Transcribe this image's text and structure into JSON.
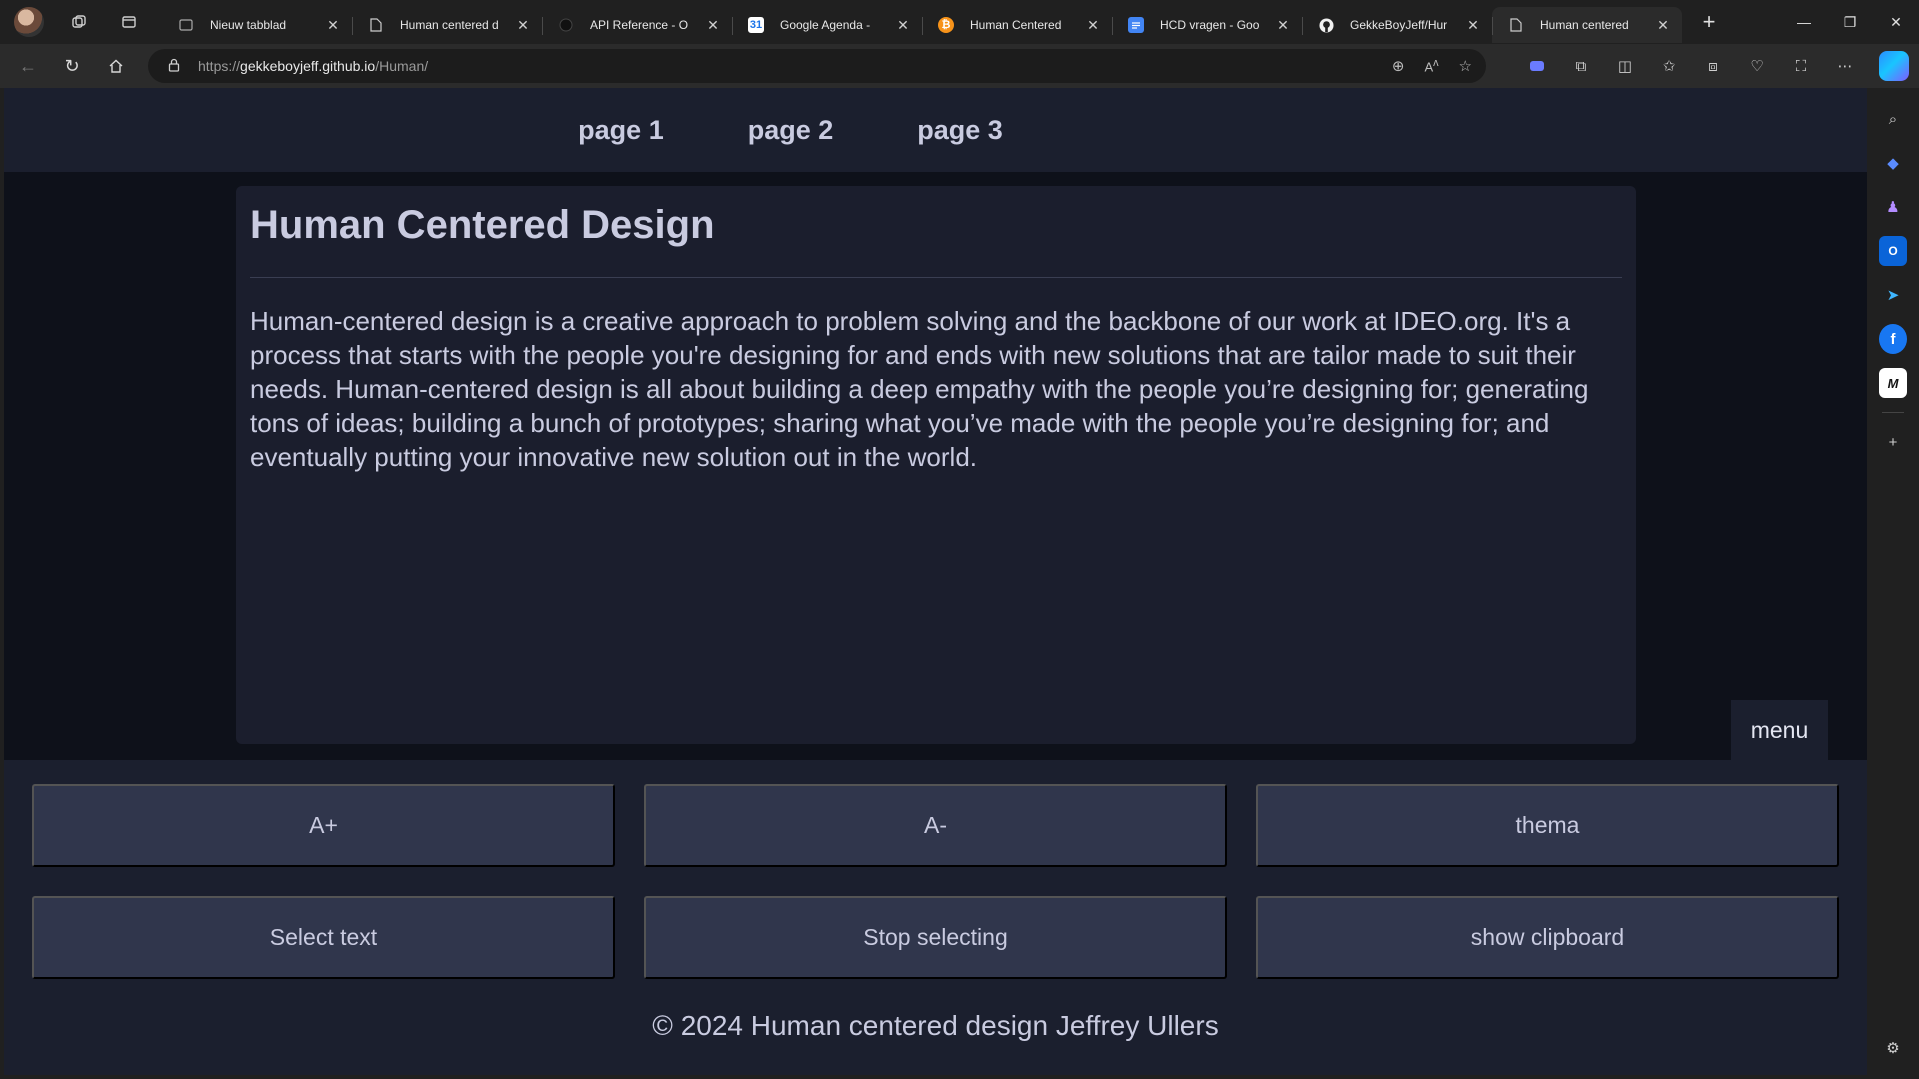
{
  "browser": {
    "tabs": [
      {
        "title": "Nieuw tabblad",
        "icon": "new-tab-page-icon",
        "active": false
      },
      {
        "title": "Human centered d",
        "icon": "document-icon",
        "active": false
      },
      {
        "title": "API Reference - O",
        "icon": "openai-icon",
        "active": false
      },
      {
        "title": "Google Agenda -",
        "icon": "google-calendar-icon",
        "active": false
      },
      {
        "title": "Human Centered",
        "icon": "bitcoin-icon",
        "active": false
      },
      {
        "title": "HCD vragen - Goo",
        "icon": "google-docs-icon",
        "active": false
      },
      {
        "title": "GekkeBoyJeff/Hur",
        "icon": "github-icon",
        "active": false
      },
      {
        "title": "Human centered",
        "icon": "document-icon",
        "active": true
      }
    ],
    "address": {
      "scheme": "https://",
      "host": "gekkeboyjeff.github.io",
      "path": "/Human/"
    }
  },
  "page": {
    "nav": [
      "page 1",
      "page 2",
      "page 3"
    ],
    "title": "Human Centered Design",
    "body": "Human-centered design is a creative approach to problem solving and the backbone of our work at IDEO.org. It's a process that starts with the people you're designing for and ends with new solutions that are tailor made to suit their needs. Human-centered design is all about building a deep empathy with the people you’re designing for; generating tons of ideas; building a bunch of prototypes; sharing what you’ve made with the people you’re designing for; and eventually putting your innovative new solution out in the world.",
    "menu_label": "menu",
    "controls": {
      "font_up": "A+",
      "font_down": "A-",
      "theme": "thema",
      "select_text": "Select text",
      "stop_selecting": "Stop selecting",
      "show_clipboard": "show clipboard"
    },
    "footer": "© 2024 Human centered design Jeffrey Ullers"
  },
  "colors": {
    "page_background": "#0e111a",
    "panel": "#1b1f2e",
    "button": "#30364c",
    "text": "#c9cbe0"
  }
}
